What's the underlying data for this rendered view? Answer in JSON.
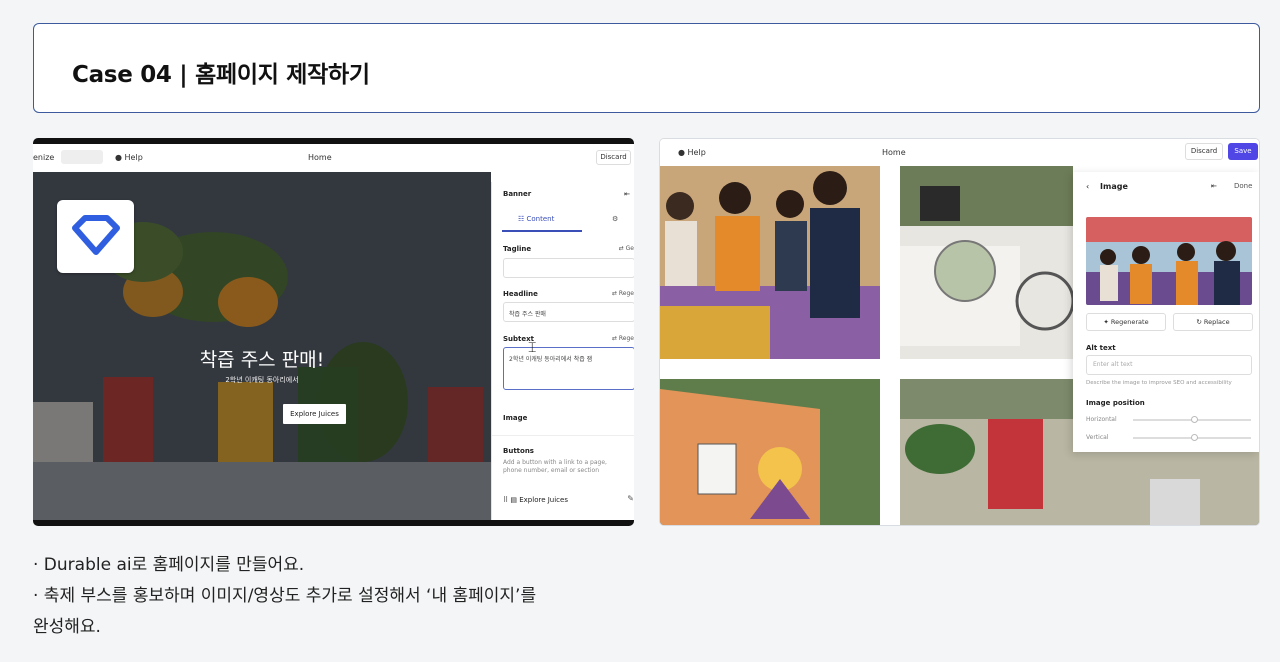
{
  "title": "Case 04 | 홈페이지 제작하기",
  "left_screenshot": {
    "topbar": {
      "partial_left": "enize",
      "help": "Help",
      "page": "Home",
      "discard": "Discard"
    },
    "hero": {
      "heading": "착즙 주스 판매!",
      "subtext": "2학년 이캐팅 동아리에서",
      "button": "Explore Juices"
    },
    "panel": {
      "section": "Banner",
      "tab_content": "Content",
      "tagline_label": "Tagline",
      "tagline_action": "Ge",
      "headline_label": "Headline",
      "headline_action": "Rege",
      "headline_value": "착즙 주스 판매",
      "subtext_label": "Subtext",
      "subtext_action": "Rege",
      "subtext_value": "2학년 이캐팅 동아리에서 착즙 잼",
      "image_label": "Image",
      "buttons_label": "Buttons",
      "buttons_hint": "Add a button with a link to a page, phone number, email or section",
      "button_item": "Explore Juices"
    }
  },
  "right_screenshot": {
    "topbar": {
      "help": "Help",
      "page": "Home",
      "discard": "Discard",
      "save": "Save"
    },
    "panel": {
      "title": "Image",
      "done": "Done",
      "regenerate": "Regenerate",
      "replace": "Replace",
      "alt_label": "Alt text",
      "alt_placeholder": "Enter alt text",
      "alt_hint": "Describe the image to improve SEO and accessibility",
      "position_label": "Image position",
      "horizontal": "Horizontal",
      "vertical": "Vertical",
      "horizontal_level": 0.52,
      "vertical_level": 0.52
    }
  },
  "description": [
    "· Durable ai로 홈페이지를 만들어요.",
    "· 축제 부스를 홍보하며 이미지/영상도 추가로 설정해서 ‘내 홈페이지’를",
    "완성해요."
  ],
  "colors": {
    "title_border": "#3d5a9e",
    "save_button": "#4f46e5",
    "logo_blue": "#2f5fe0"
  }
}
